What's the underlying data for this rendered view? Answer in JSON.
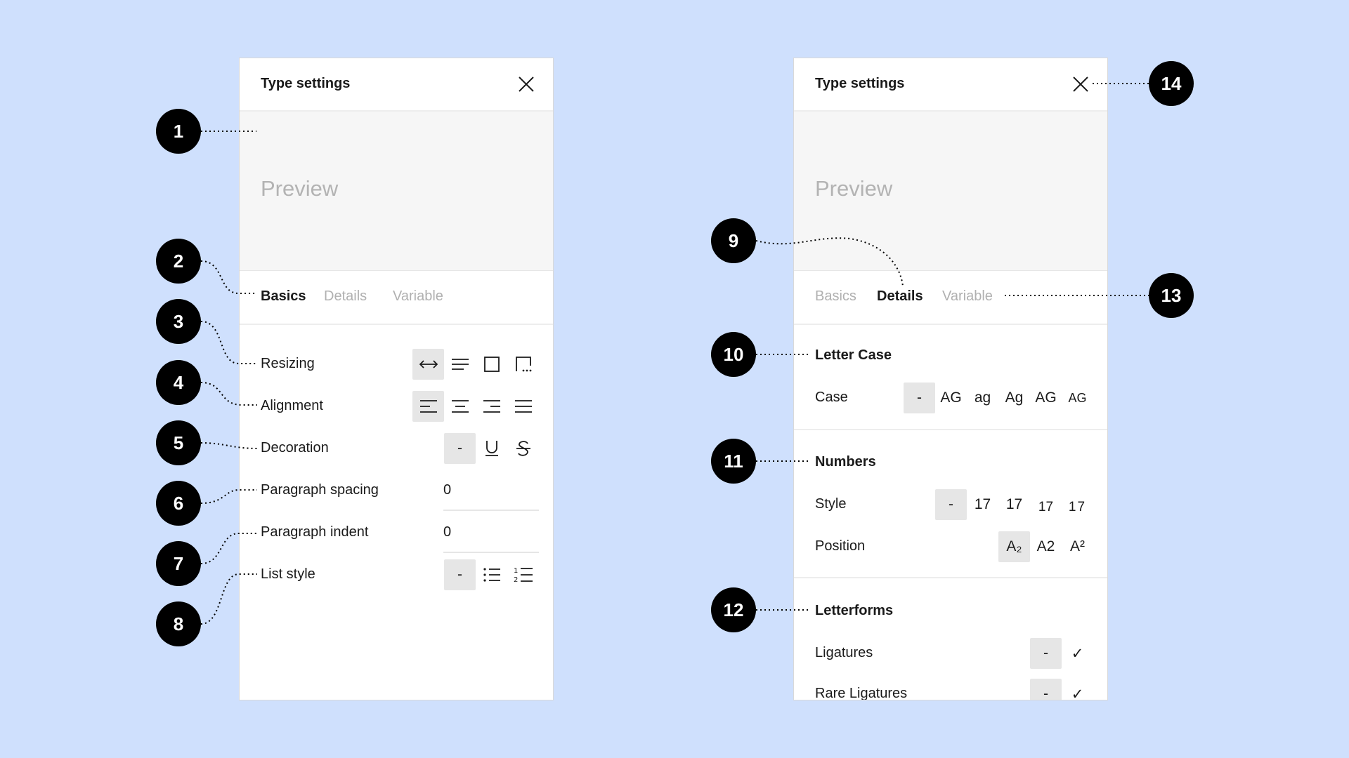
{
  "left_panel": {
    "title": "Type settings",
    "preview": "Preview",
    "tabs": [
      "Basics",
      "Details",
      "Variable"
    ],
    "active_tab": "Basics",
    "rows": {
      "resizing": "Resizing",
      "alignment": "Alignment",
      "decoration": "Decoration",
      "paragraph_spacing": "Paragraph spacing",
      "paragraph_indent": "Paragraph indent",
      "list_style": "List style"
    },
    "paragraph_spacing_value": "0",
    "paragraph_indent_value": "0",
    "none_label": "-",
    "icons": {
      "resizing": [
        "auto-width-icon",
        "auto-height-icon",
        "fixed-size-icon",
        "truncate-icon"
      ],
      "alignment": [
        "align-left-icon",
        "align-center-icon",
        "align-right-icon",
        "align-justify-icon"
      ],
      "decoration": [
        "underline-icon",
        "strikethrough-icon"
      ],
      "list": [
        "bulleted-list-icon",
        "numbered-list-icon"
      ]
    }
  },
  "right_panel": {
    "title": "Type settings",
    "preview": "Preview",
    "tabs": [
      "Basics",
      "Details",
      "Variable"
    ],
    "active_tab": "Details",
    "letter_case": {
      "title": "Letter Case",
      "case_label": "Case",
      "options": [
        "-",
        "AG",
        "ag",
        "Ag",
        "AG",
        "AG"
      ]
    },
    "numbers": {
      "title": "Numbers",
      "style_label": "Style",
      "style_options": [
        "-",
        "17",
        "17",
        "17",
        "17"
      ],
      "position_label": "Position",
      "position_options": [
        "A₂",
        "A2",
        "A²"
      ]
    },
    "letterforms": {
      "title": "Letterforms",
      "ligatures": "Ligatures",
      "rare_ligatures": "Rare Ligatures",
      "none_label": "-",
      "check": "✓"
    }
  },
  "markers": [
    "1",
    "2",
    "3",
    "4",
    "5",
    "6",
    "7",
    "8",
    "9",
    "10",
    "11",
    "12",
    "13",
    "14"
  ],
  "colors": {
    "background": "#cfe0fd",
    "panel": "#ffffff",
    "preview": "#f6f6f6",
    "selected": "#e6e6e6",
    "marker": "#000000"
  }
}
